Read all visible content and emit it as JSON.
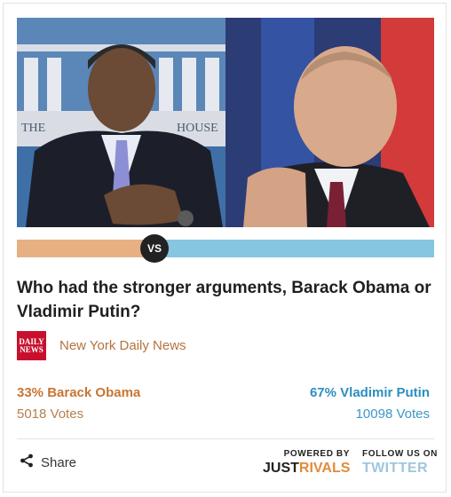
{
  "poll": {
    "question": "Who had the stronger arguments, Barack Obama or Vladimir Putin?",
    "vs_label": "VS",
    "left": {
      "name": "Barack Obama",
      "percent": 33,
      "title": "33% Barack Obama",
      "votes_text": "5018 Votes",
      "color": "#e7b083"
    },
    "right": {
      "name": "Vladimir Putin",
      "percent": 67,
      "title": "67% Vladimir Putin",
      "votes_text": "10098 Votes",
      "color": "#87c6e0"
    }
  },
  "source": {
    "name": "New York Daily News",
    "logo_line1": "DAILY",
    "logo_line2": "NEWS"
  },
  "footer": {
    "share_label": "Share",
    "powered_label": "POWERED BY",
    "brand_part1": "JUST",
    "brand_part2": "RIVALS",
    "follow_label": "FOLLOW US ON",
    "twitter_label": "TWITTER"
  }
}
